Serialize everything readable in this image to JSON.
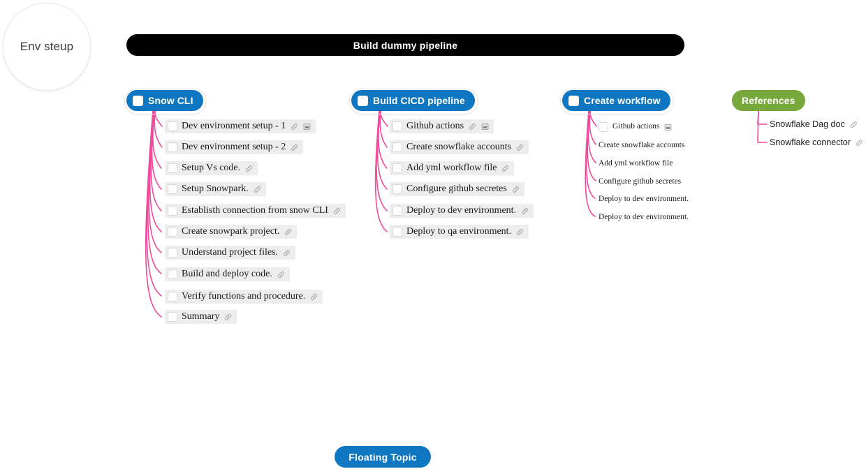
{
  "canvas": {
    "background": "#ffffff",
    "connector_color": "#ef4a9b",
    "accent_blue": "#0f76c1",
    "accent_green": "#76a83c",
    "root_color": "#000000",
    "leaf_background": "#ededed"
  },
  "circle_topic": {
    "label": "Env steup"
  },
  "root_topic": {
    "label": "Build dummy pipeline"
  },
  "floating_topic": {
    "label": "Floating Topic"
  },
  "branches": [
    {
      "id": "snow-cli",
      "label": "Snow CLI",
      "color": "#0f76c1",
      "has_checkbox": true,
      "items": [
        {
          "label": "Dev environment setup - 1",
          "checkbox": true,
          "icons": [
            "link-icon",
            "note-icon"
          ]
        },
        {
          "label": "Dev environment setup - 2",
          "checkbox": true,
          "icons": [
            "link-icon"
          ]
        },
        {
          "label": "Setup Vs code.",
          "checkbox": true,
          "icons": [
            "link-icon"
          ]
        },
        {
          "label": "Setup Snowpark.",
          "checkbox": true,
          "icons": [
            "link-icon"
          ]
        },
        {
          "label": "Establisth connection from snow CLI",
          "checkbox": true,
          "icons": [
            "link-icon"
          ]
        },
        {
          "label": "Create snowpark project.",
          "checkbox": true,
          "icons": [
            "link-icon"
          ]
        },
        {
          "label": "Understand project files.",
          "checkbox": true,
          "icons": [
            "link-icon"
          ]
        },
        {
          "label": "Build and deploy code.",
          "checkbox": true,
          "icons": [
            "link-icon"
          ]
        },
        {
          "label": "Verify functions and procedure.",
          "checkbox": true,
          "icons": [
            "link-icon"
          ]
        },
        {
          "label": "Summary",
          "checkbox": true,
          "icons": [
            "link-icon"
          ]
        }
      ]
    },
    {
      "id": "build-cicd-pipeline",
      "label": "Build CICD pipeline",
      "color": "#0f76c1",
      "has_checkbox": true,
      "items": [
        {
          "label": "Github actions",
          "checkbox": true,
          "icons": [
            "link-icon",
            "note-icon"
          ]
        },
        {
          "label": "Create snowflake accounts",
          "checkbox": true,
          "icons": [
            "link-icon"
          ]
        },
        {
          "label": "Add yml workflow file",
          "checkbox": true,
          "icons": [
            "link-icon"
          ]
        },
        {
          "label": "Configure github secretes",
          "checkbox": true,
          "icons": [
            "link-icon"
          ]
        },
        {
          "label": "Deploy to dev environment.",
          "checkbox": true,
          "icons": [
            "link-icon"
          ]
        },
        {
          "label": "Deploy to qa environment.",
          "checkbox": true,
          "icons": [
            "link-icon"
          ]
        }
      ]
    },
    {
      "id": "create-workflow",
      "label": "Create workflow",
      "color": "#0f76c1",
      "has_checkbox": true,
      "items": [
        {
          "label": "Github actions",
          "checkbox": true,
          "icons": [
            "note-icon"
          ]
        },
        {
          "label": "Create snowflake accounts",
          "checkbox": false,
          "icons": []
        },
        {
          "label": "Add yml workflow file",
          "checkbox": false,
          "icons": []
        },
        {
          "label": "Configure github secretes",
          "checkbox": false,
          "icons": []
        },
        {
          "label": "Deploy to dev environment.",
          "checkbox": false,
          "icons": []
        },
        {
          "label": "Deploy to dev environment.",
          "checkbox": false,
          "icons": []
        }
      ]
    },
    {
      "id": "references",
      "label": "References",
      "color": "#76a83c",
      "has_checkbox": false,
      "items": [
        {
          "label": "Snowflake Dag doc",
          "checkbox": false,
          "icons": [
            "link-icon"
          ]
        },
        {
          "label": "Snowflake connector",
          "checkbox": false,
          "icons": [
            "link-icon"
          ]
        }
      ]
    }
  ]
}
